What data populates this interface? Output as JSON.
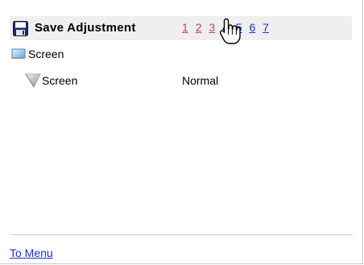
{
  "header": {
    "icon": "floppy-disk-icon",
    "title": "Save Adjustment",
    "pages": [
      {
        "label": "1",
        "state": "visited"
      },
      {
        "label": "2",
        "state": "visited"
      },
      {
        "label": "3",
        "state": "visited"
      },
      {
        "label": "4",
        "state": "current"
      },
      {
        "label": "5",
        "state": "link"
      },
      {
        "label": "6",
        "state": "link"
      },
      {
        "label": "7",
        "state": "link"
      }
    ]
  },
  "tree": {
    "root": {
      "icon": "monitor-icon",
      "label": "Screen"
    },
    "rows": [
      {
        "icon": "screen-setting-icon",
        "label": "Screen",
        "value": "Normal"
      }
    ]
  },
  "footer": {
    "menu_link": "To Menu"
  },
  "colors": {
    "visited_link": "#c0406a",
    "link": "#2030c8",
    "header_bg": "#efefef"
  }
}
